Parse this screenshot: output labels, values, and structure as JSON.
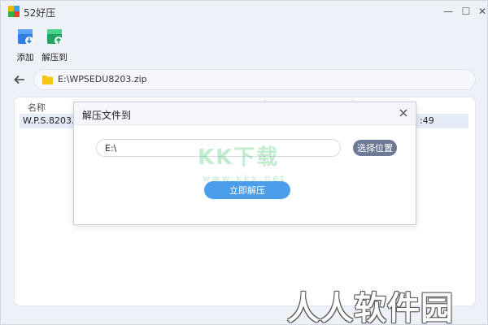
{
  "window": {
    "title": "52好压",
    "controls": {
      "minimize": "—",
      "maximize": "☐",
      "close": "✕"
    }
  },
  "toolbar": {
    "add_label": "添加",
    "extract_to_label": "解压到"
  },
  "pathbar": {
    "path": "E:\\WPSEDU8203.zip"
  },
  "file_list": {
    "columns": [
      "名称"
    ],
    "rows": [
      {
        "name": "W.P.S.8203.30.",
        "time_fragment": ":49"
      }
    ]
  },
  "dialog": {
    "title": "解压文件到",
    "destination_value": "E:\\",
    "choose_location_label": "选择位置",
    "extract_now_label": "立即解压"
  },
  "watermarks": {
    "center_main": "KK下载",
    "center_url": "www.kkx.net",
    "corner": "人人软件园"
  },
  "colors": {
    "accent_blue": "#4c9eea",
    "secondary_button": "#6d7a96",
    "selected_row": "#e6ebf8"
  }
}
